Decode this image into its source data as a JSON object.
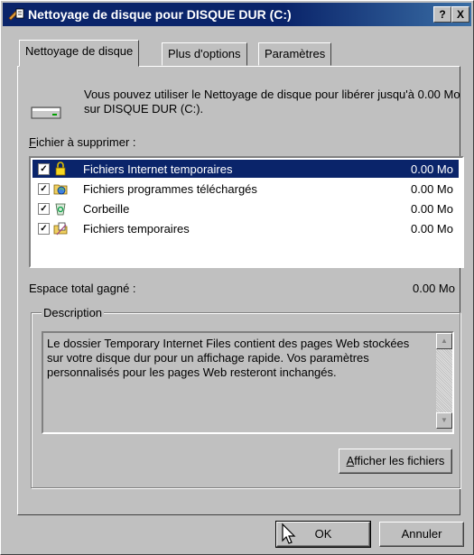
{
  "window": {
    "title": "Nettoyage de disque pour DISQUE DUR (C:)",
    "help_label": "?",
    "close_label": "X"
  },
  "tabs": [
    {
      "label": "Nettoyage de disque"
    },
    {
      "label": "Plus d'options"
    },
    {
      "label": "Paramètres"
    }
  ],
  "info": {
    "text": "Vous pouvez utiliser le Nettoyage de disque pour libérer jusqu'à 0.00 Mo sur DISQUE DUR (C:)."
  },
  "files_section": {
    "mnemonic": "F",
    "label_rest": "ichier à supprimer :"
  },
  "files": [
    {
      "name": "Fichiers Internet temporaires",
      "size": "0.00 Mo",
      "checked": true,
      "selected": true,
      "icon": "lock-icon"
    },
    {
      "name": "Fichiers programmes téléchargés",
      "size": "0.00 Mo",
      "checked": true,
      "selected": false,
      "icon": "downloaded-programs-icon"
    },
    {
      "name": "Corbeille",
      "size": "0.00 Mo",
      "checked": true,
      "selected": false,
      "icon": "recycle-bin-icon"
    },
    {
      "name": "Fichiers temporaires",
      "size": "0.00 Mo",
      "checked": true,
      "selected": false,
      "icon": "temp-files-icon"
    }
  ],
  "total": {
    "label": "Espace total gagné :",
    "value": "0.00 Mo"
  },
  "description": {
    "label": "Description",
    "text": "Le dossier Temporary Internet Files contient des pages Web stockées sur votre disque dur pour un affichage rapide. Vos paramètres personnalisés pour les pages Web resteront inchangés."
  },
  "view_files": {
    "mnemonic": "A",
    "label_rest": "fficher les fichiers"
  },
  "buttons": {
    "ok": "OK",
    "cancel": "Annuler"
  },
  "colors": {
    "face": "#c0c0c0",
    "title": "#0a246a",
    "selection": "#0a246a"
  }
}
